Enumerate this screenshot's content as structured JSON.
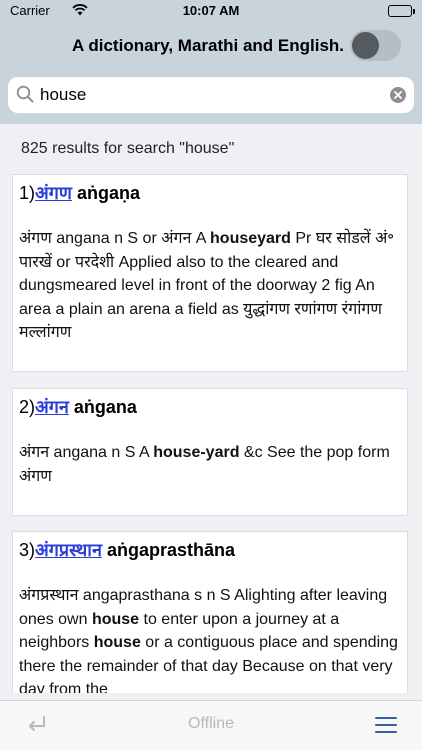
{
  "status": {
    "carrier": "Carrier",
    "time": "10:07 AM"
  },
  "header": {
    "title": "A dictionary, Marathi and English."
  },
  "search": {
    "value": "house"
  },
  "results_count": "825 results for search \"house\"",
  "results": [
    {
      "num": "1)",
      "word": "अंगण",
      "translit": "aṅgaṇa",
      "body": [
        {
          "t": "अंगण angana n S or अंगन A "
        },
        {
          "t": "houseyard",
          "b": true
        },
        {
          "t": " Pr घर सोडलें अं॰ पारखें or परदेशी Applied also to the cleared and dungsmeared level in front of the doorway 2 fig An area a plain an arena a field as युद्धांगण रणांगण रंगांगण मल्लांगण"
        }
      ]
    },
    {
      "num": "2)",
      "word": "अंगन",
      "translit": "aṅgana",
      "body": [
        {
          "t": "अंगन angana n S A "
        },
        {
          "t": "house-yard",
          "b": true
        },
        {
          "t": " &c See the pop form अंगण"
        }
      ]
    },
    {
      "num": "3)",
      "word": "अंगप्रस्थान",
      "translit": "aṅgaprasthāna",
      "body": [
        {
          "t": "अंगप्रस्थान angaprasthana s n S Alighting after leaving ones own "
        },
        {
          "t": "house",
          "b": true
        },
        {
          "t": " to enter upon a journey at a neighbors "
        },
        {
          "t": "house",
          "b": true
        },
        {
          "t": " or a contiguous place and spending there the remainder of that day Because on that very day from the"
        }
      ]
    }
  ],
  "tabbar": {
    "offline": "Offline"
  }
}
